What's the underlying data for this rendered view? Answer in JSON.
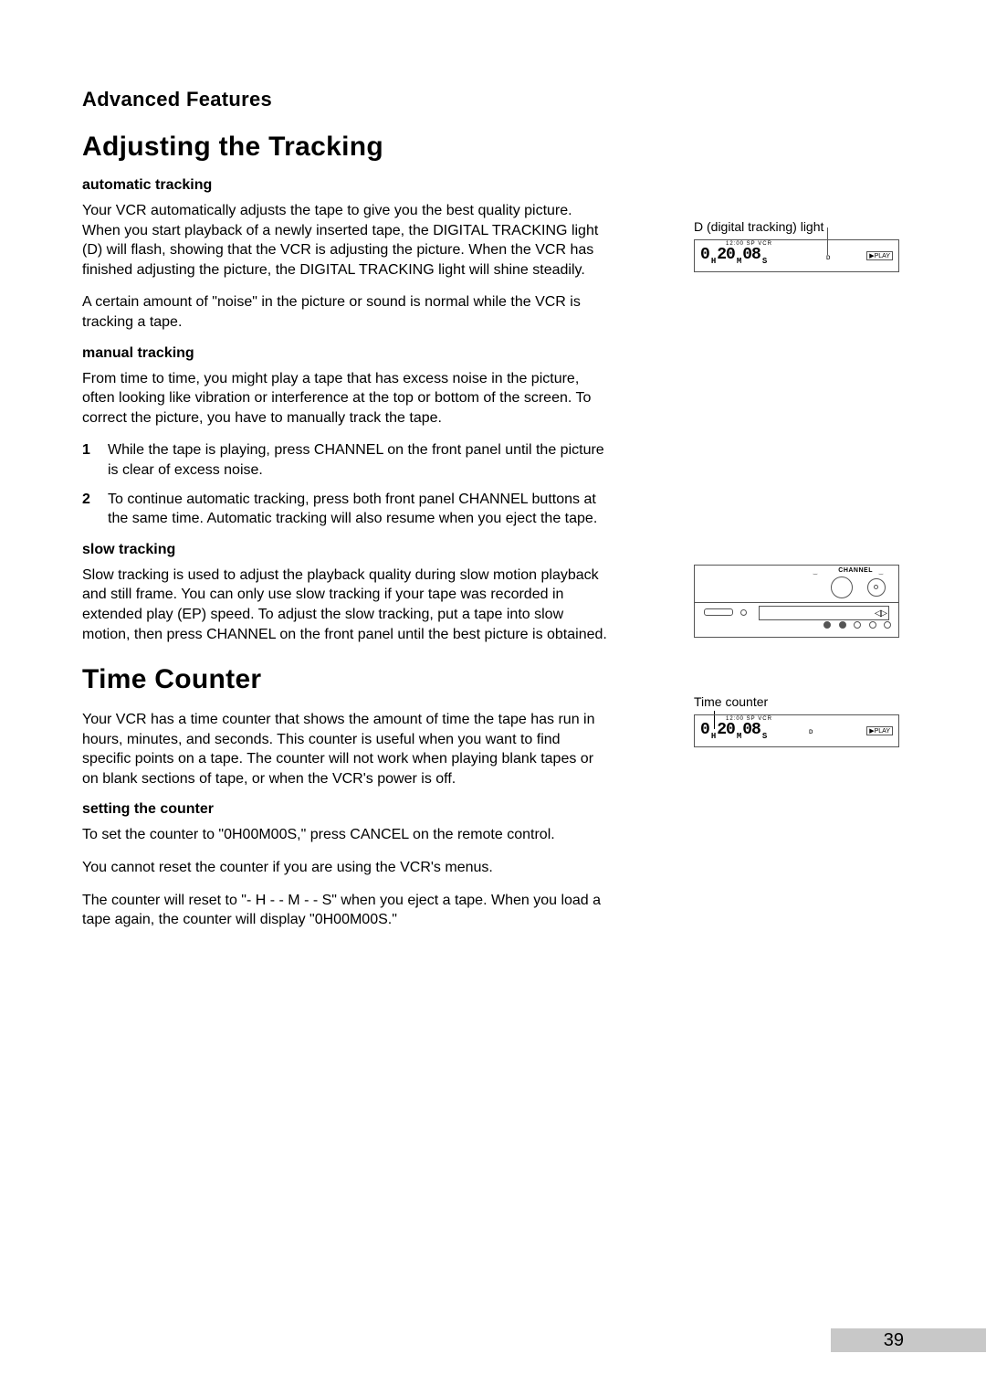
{
  "header": "Advanced Features",
  "tracking": {
    "title": "Adjusting the Tracking",
    "auto": {
      "heading": "automatic tracking",
      "p1": "Your VCR automatically adjusts the tape to give you the best quality picture. When you start playback of a newly inserted tape, the DIGITAL TRACKING light (D) will flash, showing that the VCR is adjusting the picture. When the VCR has finished adjusting the picture, the DIGITAL TRACKING light will shine steadily.",
      "p2": "A certain amount of \"noise\" in the picture or sound is normal while the VCR is tracking a tape."
    },
    "manual": {
      "heading": "manual tracking",
      "p1": "From time to time, you might play a tape that has excess noise in the picture, often looking like vibration or interference at the top or bottom of the screen. To correct the picture, you have to manually track the tape.",
      "step1_num": "1",
      "step1": "While the tape is playing, press CHANNEL on the front panel until the picture is clear of excess noise.",
      "step2_num": "2",
      "step2": "To continue automatic tracking, press both front panel CHANNEL buttons at the same time. Automatic tracking will also resume when you eject the tape."
    },
    "slow": {
      "heading": "slow tracking",
      "p1": "Slow tracking is used to adjust the playback quality during slow motion playback and still frame. You can only use slow tracking if your tape was recorded in extended play (EP) speed. To adjust the slow tracking, put a tape into slow motion, then press CHANNEL on the front panel until the best picture is obtained."
    }
  },
  "timecounter": {
    "title": "Time Counter",
    "p1": "Your VCR has a time counter that shows the amount of time the tape has run in hours, minutes, and seconds. This counter is useful when you want to find specific points on a tape. The counter will not work when playing blank tapes or on blank sections of tape, or when the VCR's power is off.",
    "setting": {
      "heading": "setting the counter",
      "p1": "To set the counter to \"0H00M00S,\" press CANCEL on the remote control.",
      "p2": "You cannot reset the counter if you are using the VCR's menus.",
      "p3": "The counter will reset to \"- H - - M - - S\" when you eject a tape. When you load a tape again, the counter will display \"0H00M00S.\""
    }
  },
  "figures": {
    "digital_tracking": {
      "label": "D (digital tracking) light",
      "indicators": "12:00  SP  VCR",
      "main": "0H20M08S",
      "play": "▶PLAY"
    },
    "channel": {
      "label": "CHANNEL"
    },
    "timecounter": {
      "label": "Time counter",
      "indicators": "12:00  SP  VCR",
      "main": "0H20M08S",
      "play": "▶PLAY"
    }
  },
  "page_number": "39"
}
